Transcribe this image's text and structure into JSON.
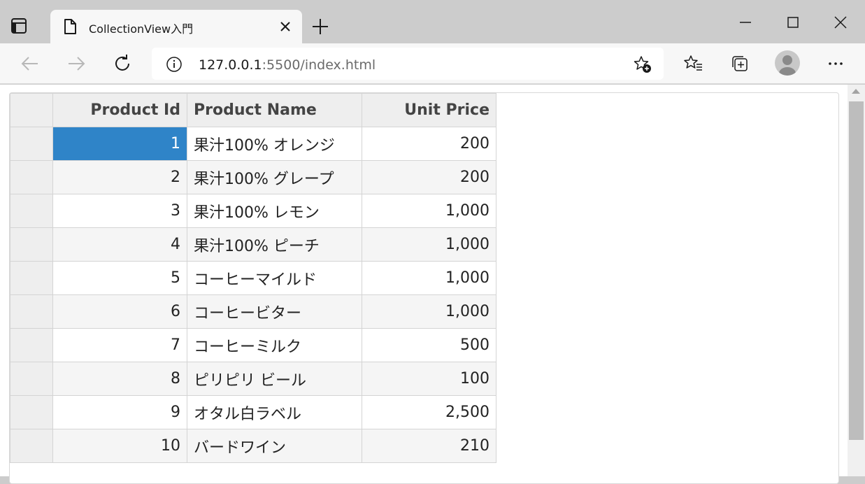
{
  "browser": {
    "tab_title": "CollectionView入門",
    "url_host": "127.0.0.1",
    "url_rest": ":5500/index.html"
  },
  "grid": {
    "columns": {
      "id": "Product Id",
      "name": "Product Name",
      "price": "Unit Price"
    },
    "selected_cell": "row-1-id",
    "rows": [
      {
        "id": "1",
        "name": "果汁100% オレンジ",
        "price": "200"
      },
      {
        "id": "2",
        "name": "果汁100% グレープ",
        "price": "200"
      },
      {
        "id": "3",
        "name": "果汁100% レモン",
        "price": "1,000"
      },
      {
        "id": "4",
        "name": "果汁100% ピーチ",
        "price": "1,000"
      },
      {
        "id": "5",
        "name": "コーヒーマイルド",
        "price": "1,000"
      },
      {
        "id": "6",
        "name": "コーヒービター",
        "price": "1,000"
      },
      {
        "id": "7",
        "name": "コーヒーミルク",
        "price": "500"
      },
      {
        "id": "8",
        "name": "ピリピリ ビール",
        "price": "100"
      },
      {
        "id": "9",
        "name": "オタル白ラベル",
        "price": "2,500"
      },
      {
        "id": "10",
        "name": "バードワイン",
        "price": "210"
      }
    ]
  },
  "colors": {
    "selection": "#2f84c8",
    "header_bg": "#eeeeee",
    "alt_row_bg": "#f5f5f5"
  }
}
